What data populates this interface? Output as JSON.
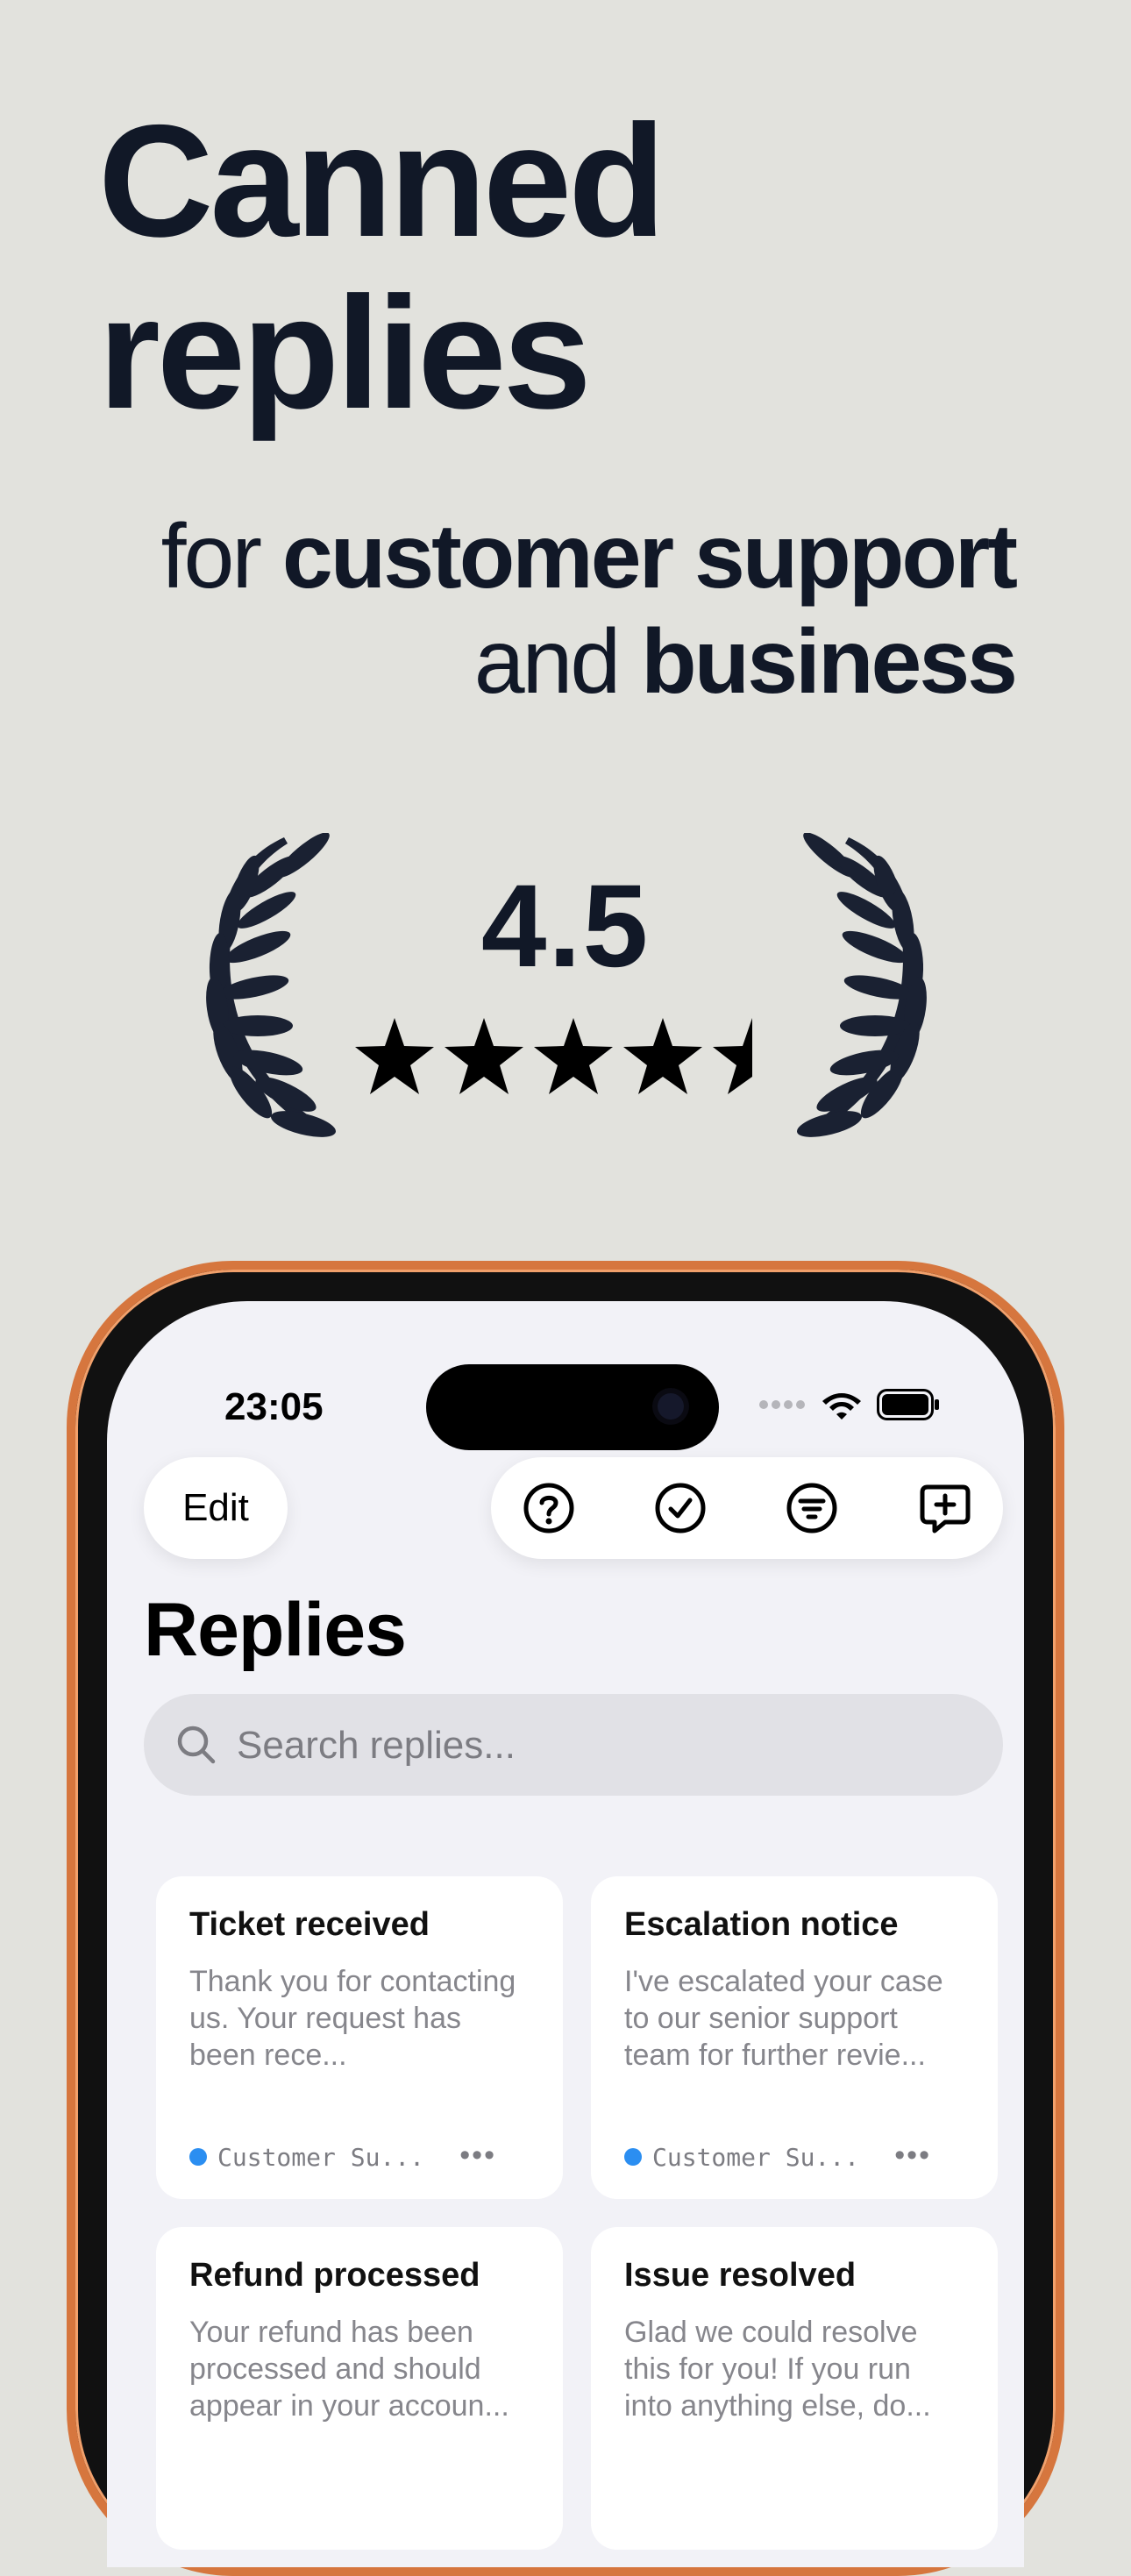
{
  "headline": {
    "line1": "Canned",
    "line2": "replies"
  },
  "tagline": {
    "pre": "for",
    "strong1": "customer support",
    "mid": "and",
    "strong2": "business"
  },
  "rating": {
    "value": "4.5",
    "stars": 4.5
  },
  "phone": {
    "status_time": "23:05",
    "edit_label": "Edit",
    "toolbar_icons": [
      "help-icon",
      "checkmark-icon",
      "filter-icon",
      "new-reply-icon"
    ],
    "title": "Replies",
    "search_placeholder": "Search replies...",
    "cards": [
      {
        "title": "Ticket received",
        "body": "Thank you for contacting us. Your request has been rece...",
        "category": "Customer Su...",
        "category_color": "#2b8ef1"
      },
      {
        "title": "Escalation notice",
        "body": "I've escalated your case to our senior support team for further revie...",
        "category": "Customer Su...",
        "category_color": "#2b8ef1"
      },
      {
        "title": "Refund processed",
        "body": "Your refund has been processed and should appear in your accoun..."
      },
      {
        "title": "Issue resolved",
        "body": "Glad we could resolve this for you! If you run into anything else, do..."
      }
    ]
  },
  "colors": {
    "background": "#e2e2dd",
    "text": "#111827",
    "phone_frame": "#d6763e",
    "accent": "#2b8ef1"
  }
}
